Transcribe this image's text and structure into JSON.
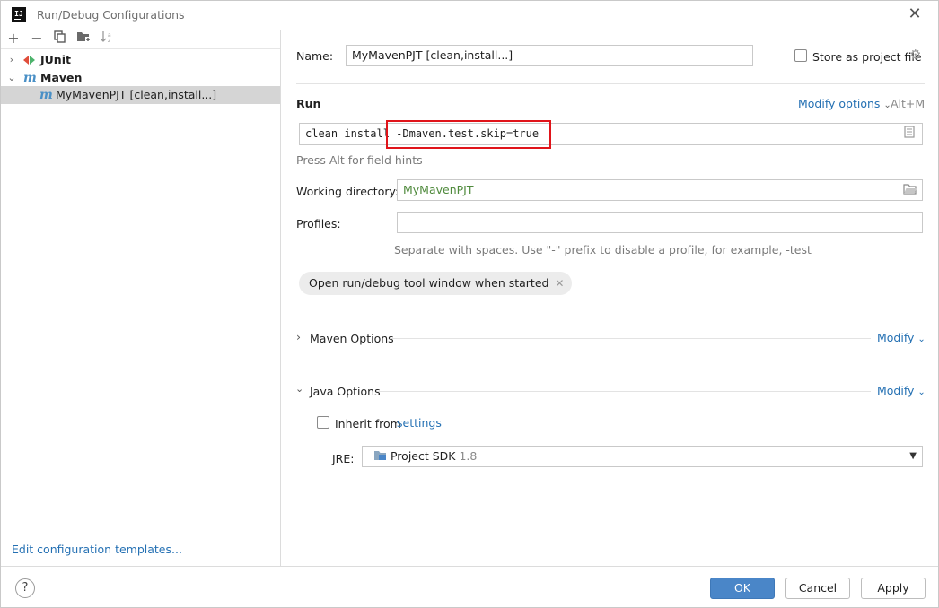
{
  "window": {
    "title": "Run/Debug Configurations",
    "app_logo": "IJ"
  },
  "toolbar": {
    "icons": [
      "plus-icon",
      "minus-icon",
      "copy-icon",
      "folder-add-icon",
      "sort-icon"
    ]
  },
  "tree": {
    "junit_label": "JUnit",
    "maven_label": "Maven",
    "maven_child_label": "MyMavenPJT [clean,install...]"
  },
  "left_footer": {
    "edit_templates": "Edit configuration templates..."
  },
  "form": {
    "name_label": "Name:",
    "name_value": "MyMavenPJT [clean,install...]",
    "store_as_project_file": "Store as project file",
    "run_section": "Run",
    "modify_options": "Modify options",
    "modify_shortcut": "Alt+M",
    "command_prefix": "clean install ",
    "command_highlight": "-Dmaven.test.skip=true",
    "field_hint": "Press Alt for field hints",
    "working_dir_label": "Working directory:",
    "working_dir_value": "MyMavenPJT",
    "profiles_label": "Profiles:",
    "profiles_value": "",
    "profiles_hint": "Separate with spaces. Use \"-\" prefix to disable a profile, for example, -test",
    "chip_label": "Open run/debug tool window when started",
    "maven_options": "Maven Options",
    "java_options": "Java Options",
    "modify": "Modify",
    "inherit_from": "Inherit from",
    "settings_link": "settings",
    "jre_label": "JRE:",
    "jre_value": "Project SDK",
    "jre_version": "1.8"
  },
  "buttons": {
    "help": "?",
    "ok": "OK",
    "cancel": "Cancel",
    "apply": "Apply"
  },
  "colors": {
    "accent": "#4a86c8",
    "link": "#2470b3",
    "highlight_border": "#e0141a",
    "selection": "#d5d5d5"
  }
}
